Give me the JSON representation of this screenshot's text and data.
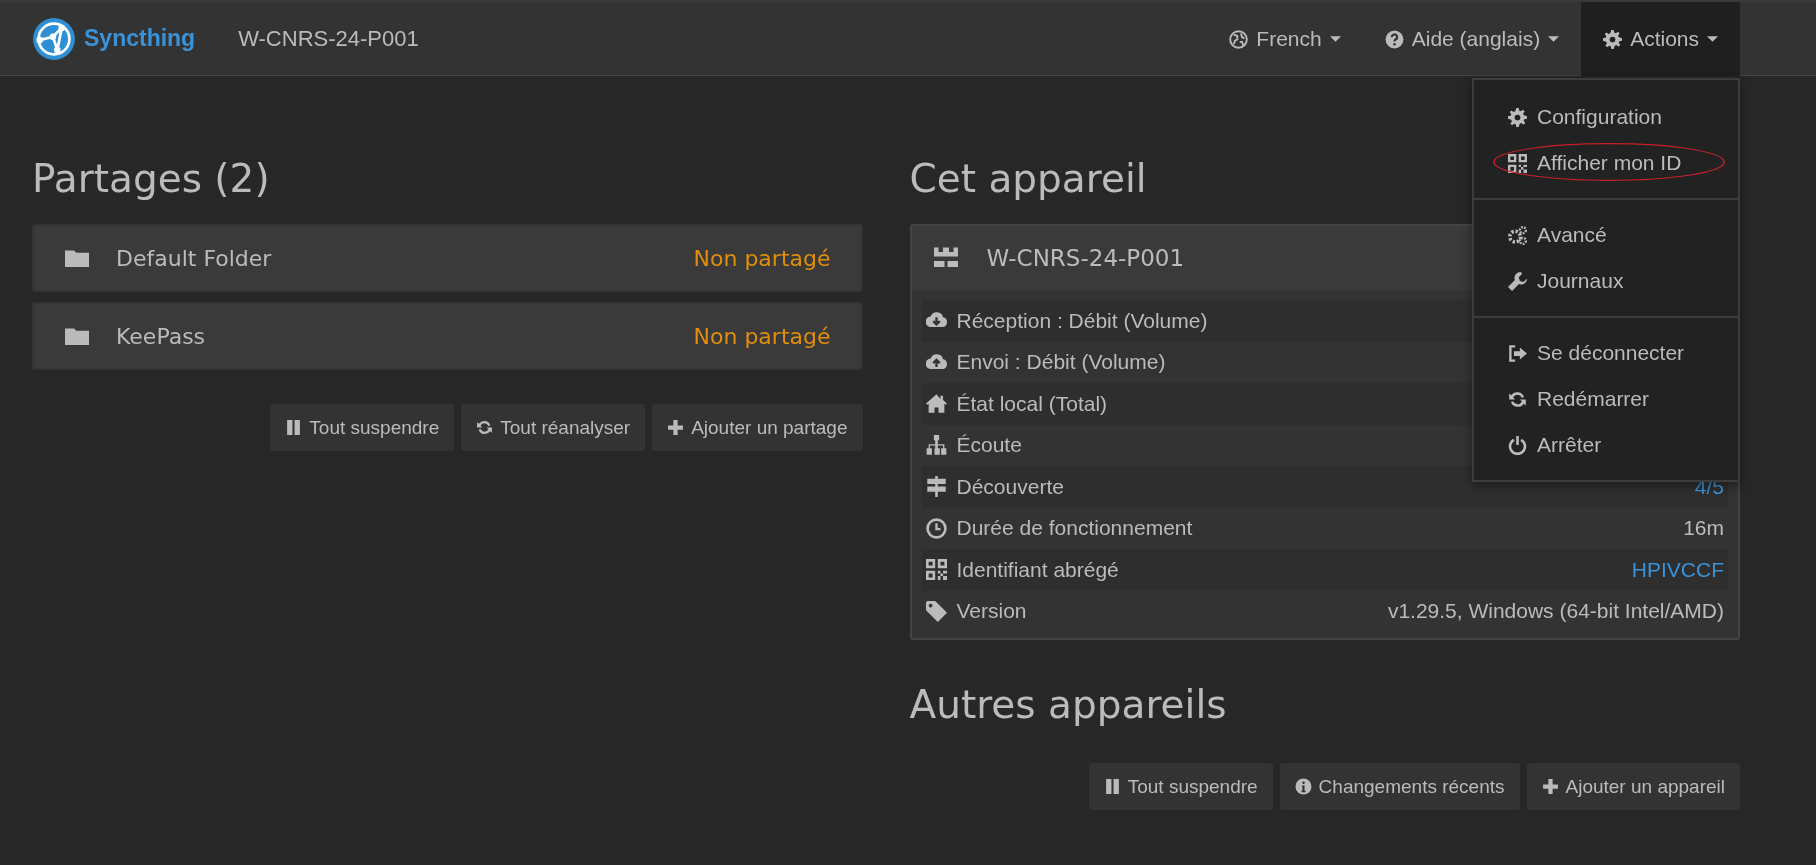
{
  "navbar": {
    "brand": "Syncthing",
    "device_name": "W-CNRS-24-P001",
    "menus": [
      {
        "label": "French",
        "selected": false
      },
      {
        "label": "Aide (anglais)",
        "selected": false
      },
      {
        "label": "Actions",
        "selected": true
      }
    ]
  },
  "actions_menu": {
    "groups": [
      [
        {
          "label": "Configuration",
          "highlighted": false
        },
        {
          "label": "Afficher mon ID",
          "highlighted": true
        }
      ],
      [
        {
          "label": "Avancé",
          "highlighted": false
        },
        {
          "label": "Journaux",
          "highlighted": false
        }
      ],
      [
        {
          "label": "Se déconnecter",
          "highlighted": false
        },
        {
          "label": "Redémarrer",
          "highlighted": false
        },
        {
          "label": "Arrêter",
          "highlighted": false
        }
      ]
    ]
  },
  "folders": {
    "title": "Partages (2)",
    "items": [
      {
        "name": "Default Folder",
        "status": "Non partagé"
      },
      {
        "name": "KeePass",
        "status": "Non partagé"
      }
    ],
    "buttons": [
      "Tout suspendre",
      "Tout réanalyser",
      "Ajouter un partage"
    ]
  },
  "this_device": {
    "title": "Cet appareil",
    "name": "W-CNRS-24-P001",
    "rows": [
      {
        "label": "Réception : Débit (Volume)"
      },
      {
        "label": "Envoi : Débit (Volume)"
      },
      {
        "label": "État local (Total)"
      },
      {
        "label": "Écoute"
      },
      {
        "label": "Découverte",
        "value": "4/5",
        "kind": "link"
      },
      {
        "label": "Durée de fonctionnement",
        "value": "16m",
        "kind": "text"
      },
      {
        "label": "Identifiant abrégé",
        "value": "HPIVCCF",
        "kind": "link"
      },
      {
        "label": "Version",
        "value": "v1.29.5, Windows (64-bit Intel/AMD)",
        "kind": "text"
      }
    ]
  },
  "other_devices": {
    "title": "Autres appareils",
    "buttons": [
      "Tout suspendre",
      "Changements récents",
      "Ajouter un appareil"
    ]
  }
}
